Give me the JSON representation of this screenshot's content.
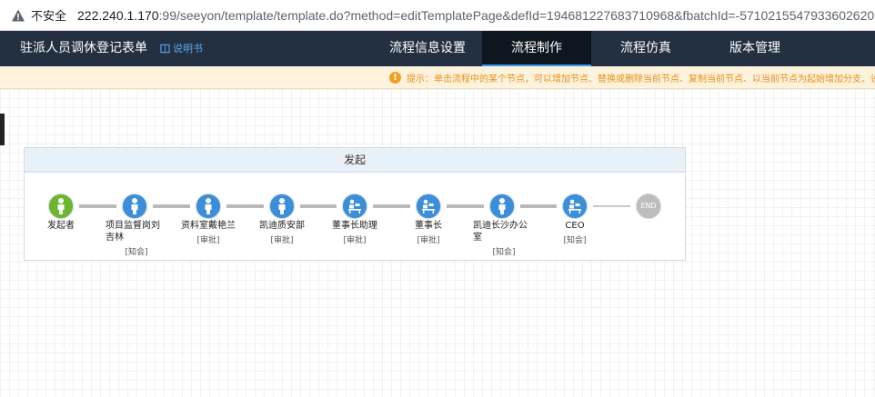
{
  "browser": {
    "security_label": "不安全",
    "url_host": "222.240.1.170",
    "url_rest": ":99/seeyon/template/template.do?method=editTemplatePage&defId=194681227683710968&fbatchId=-5710215547933602620"
  },
  "header": {
    "title": "驻派人员调休登记表单",
    "manual_label": "说明书",
    "tabs": [
      {
        "label": "流程信息设置"
      },
      {
        "label": "流程制作"
      },
      {
        "label": "流程仿真"
      },
      {
        "label": "版本管理"
      }
    ]
  },
  "tip": {
    "text": "提示：单击流程中的某个节点，可以增加节点、替换或删除当前节点、复制当前节点、以当前节点为起始增加分支、设置节点属性"
  },
  "flow": {
    "header_label": "发起",
    "colors": {
      "start": "#6cb52d",
      "node": "#3c8ed8",
      "end": "#bdbdbd"
    },
    "nodes": [
      {
        "label": "发起者",
        "role": "",
        "icon": "person-icon"
      },
      {
        "label": "项目监督岗刘吉林",
        "role": "[知会]",
        "icon": "person-icon"
      },
      {
        "label": "资料室戴艳兰",
        "role": "[审批]",
        "icon": "person-icon"
      },
      {
        "label": "凯迪质安部",
        "role": "[审批]",
        "icon": "person-icon"
      },
      {
        "label": "董事长助理",
        "role": "[审批]",
        "icon": "post-icon"
      },
      {
        "label": "董事长",
        "role": "[审批]",
        "icon": "post-icon"
      },
      {
        "label": "凯迪长沙办公室",
        "role": "[知会]",
        "icon": "person-icon"
      },
      {
        "label": "CEO",
        "role": "[知会]",
        "icon": "post-icon"
      }
    ],
    "end_label": "END"
  }
}
